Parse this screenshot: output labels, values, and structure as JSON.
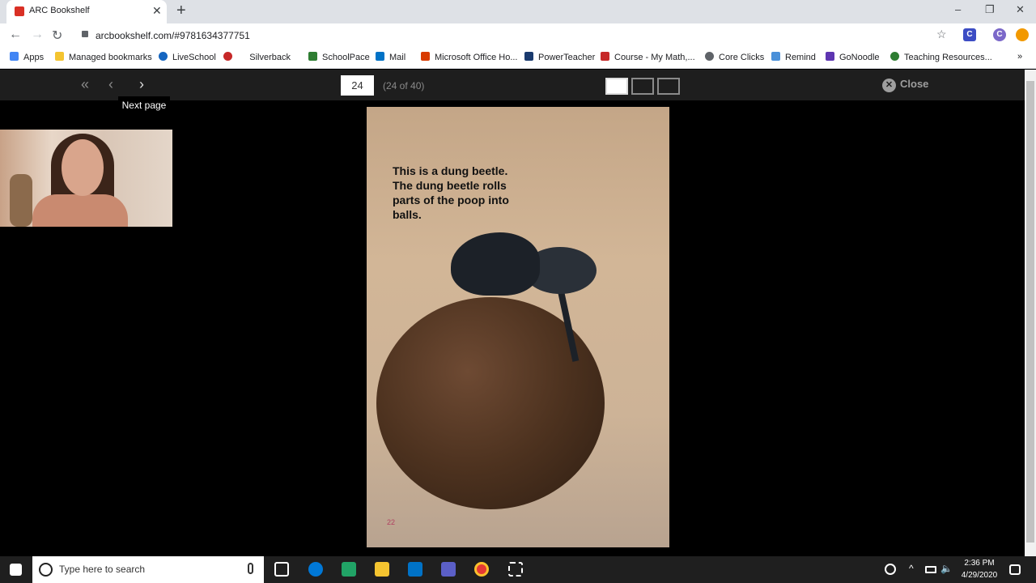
{
  "browser": {
    "tab_title": "ARC Bookshelf",
    "url": "arcbookshelf.com/#9781634377751",
    "bookmarks": [
      "Apps",
      "Managed bookmarks",
      "LiveSchool",
      "Silverback",
      "SchoolPace",
      "Mail",
      "Microsoft Office Ho...",
      "PowerTeacher",
      "Course - My Math,...",
      "Core Clicks",
      "Remind",
      "GoNoodle",
      "Teaching Resources..."
    ],
    "more_bookmarks": "»"
  },
  "viewer": {
    "page_input": "24",
    "page_count": "(24 of 40)",
    "close_label": "Close",
    "tooltip": "Next page"
  },
  "book": {
    "text": "This is a dung beetle. The dung beetle rolls parts of the poop into balls.",
    "page_number": "22"
  },
  "taskbar": {
    "search_placeholder": "Type here to search",
    "time": "2:36 PM",
    "date": "4/29/2020"
  },
  "colors": {
    "accent_red": "#d93025",
    "viewer_bar": "#1e1e1e"
  }
}
